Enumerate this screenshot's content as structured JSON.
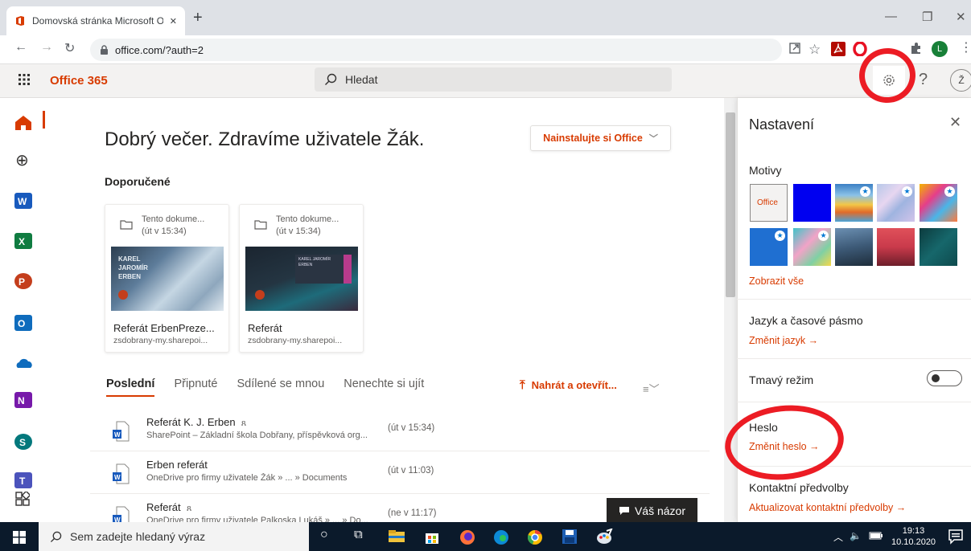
{
  "browser": {
    "tab_title": "Domovská stránka Microsoft Offi",
    "tab_close": "✕",
    "new_tab": "+",
    "url": "office.com/?auth=2",
    "profile_letter": "L"
  },
  "office": {
    "brand": "Office 365",
    "search_placeholder": "Hledat",
    "help": "?",
    "avatar_letter": "Ž"
  },
  "main": {
    "greeting": "Dobrý večer. Zdravíme uživatele Žák.",
    "install_button": "Nainstalujte si Office",
    "recommended_title": "Doporučené",
    "cards": [
      {
        "title": "Tento dokume...",
        "when": "(út v 15:34)",
        "thumb_text": [
          "KAREL",
          "JAROMÍR",
          "ERBEN"
        ],
        "name": "Referát ErbenPreze...",
        "source": "zsdobrany-my.sharepoi..."
      },
      {
        "title": "Tento dokume...",
        "when": "(út v 15:34)",
        "thumb_text": [
          "KAREL JAROMÍR",
          "ERBEN"
        ],
        "name": "Referát",
        "source": "zsdobrany-my.sharepoi..."
      }
    ],
    "tabs": [
      "Poslední",
      "Připnuté",
      "Sdílené se mnou",
      "Nenechte si ujít"
    ],
    "upload_button": "Nahrát a otevřít...",
    "files": [
      {
        "name": "Referát K. J. Erben",
        "shared": "ጸ",
        "path": "SharePoint – Základní škola Dobřany, příspěvková org...",
        "date": "(út v 15:34)"
      },
      {
        "name": "Erben referát",
        "shared": "",
        "path": "OneDrive pro firmy uživatele Žák » ... » Documents",
        "date": "(út v 11:03)"
      },
      {
        "name": "Referát",
        "shared": "ጸ",
        "path": "OneDrive pro firmy uživatele Palkoska Lukáš » ... » Do...",
        "date": "(ne v 11:17)"
      }
    ],
    "feedback_button": "Váš názor"
  },
  "settings": {
    "title": "Nastavení",
    "close": "✕",
    "themes_title": "Motivy",
    "theme_office_label": "Office",
    "show_all": "Zobrazit vše",
    "language_title": "Jazyk a časové pásmo",
    "change_language": "Změnit jazyk →",
    "dark_mode_title": "Tmavý režim",
    "password_title": "Heslo",
    "change_password": "Změnit heslo →",
    "contact_title": "Kontaktní předvolby",
    "update_contact": "Aktualizovat kontaktní předvolby →"
  },
  "taskbar": {
    "search_placeholder": "Sem zadejte hledaný výraz",
    "time": "19:13",
    "date": "10.10.2020"
  },
  "colors": {
    "office_accent": "#d83b01",
    "annotation_red": "#ec1c24",
    "taskbar": "#0b1a2b"
  }
}
